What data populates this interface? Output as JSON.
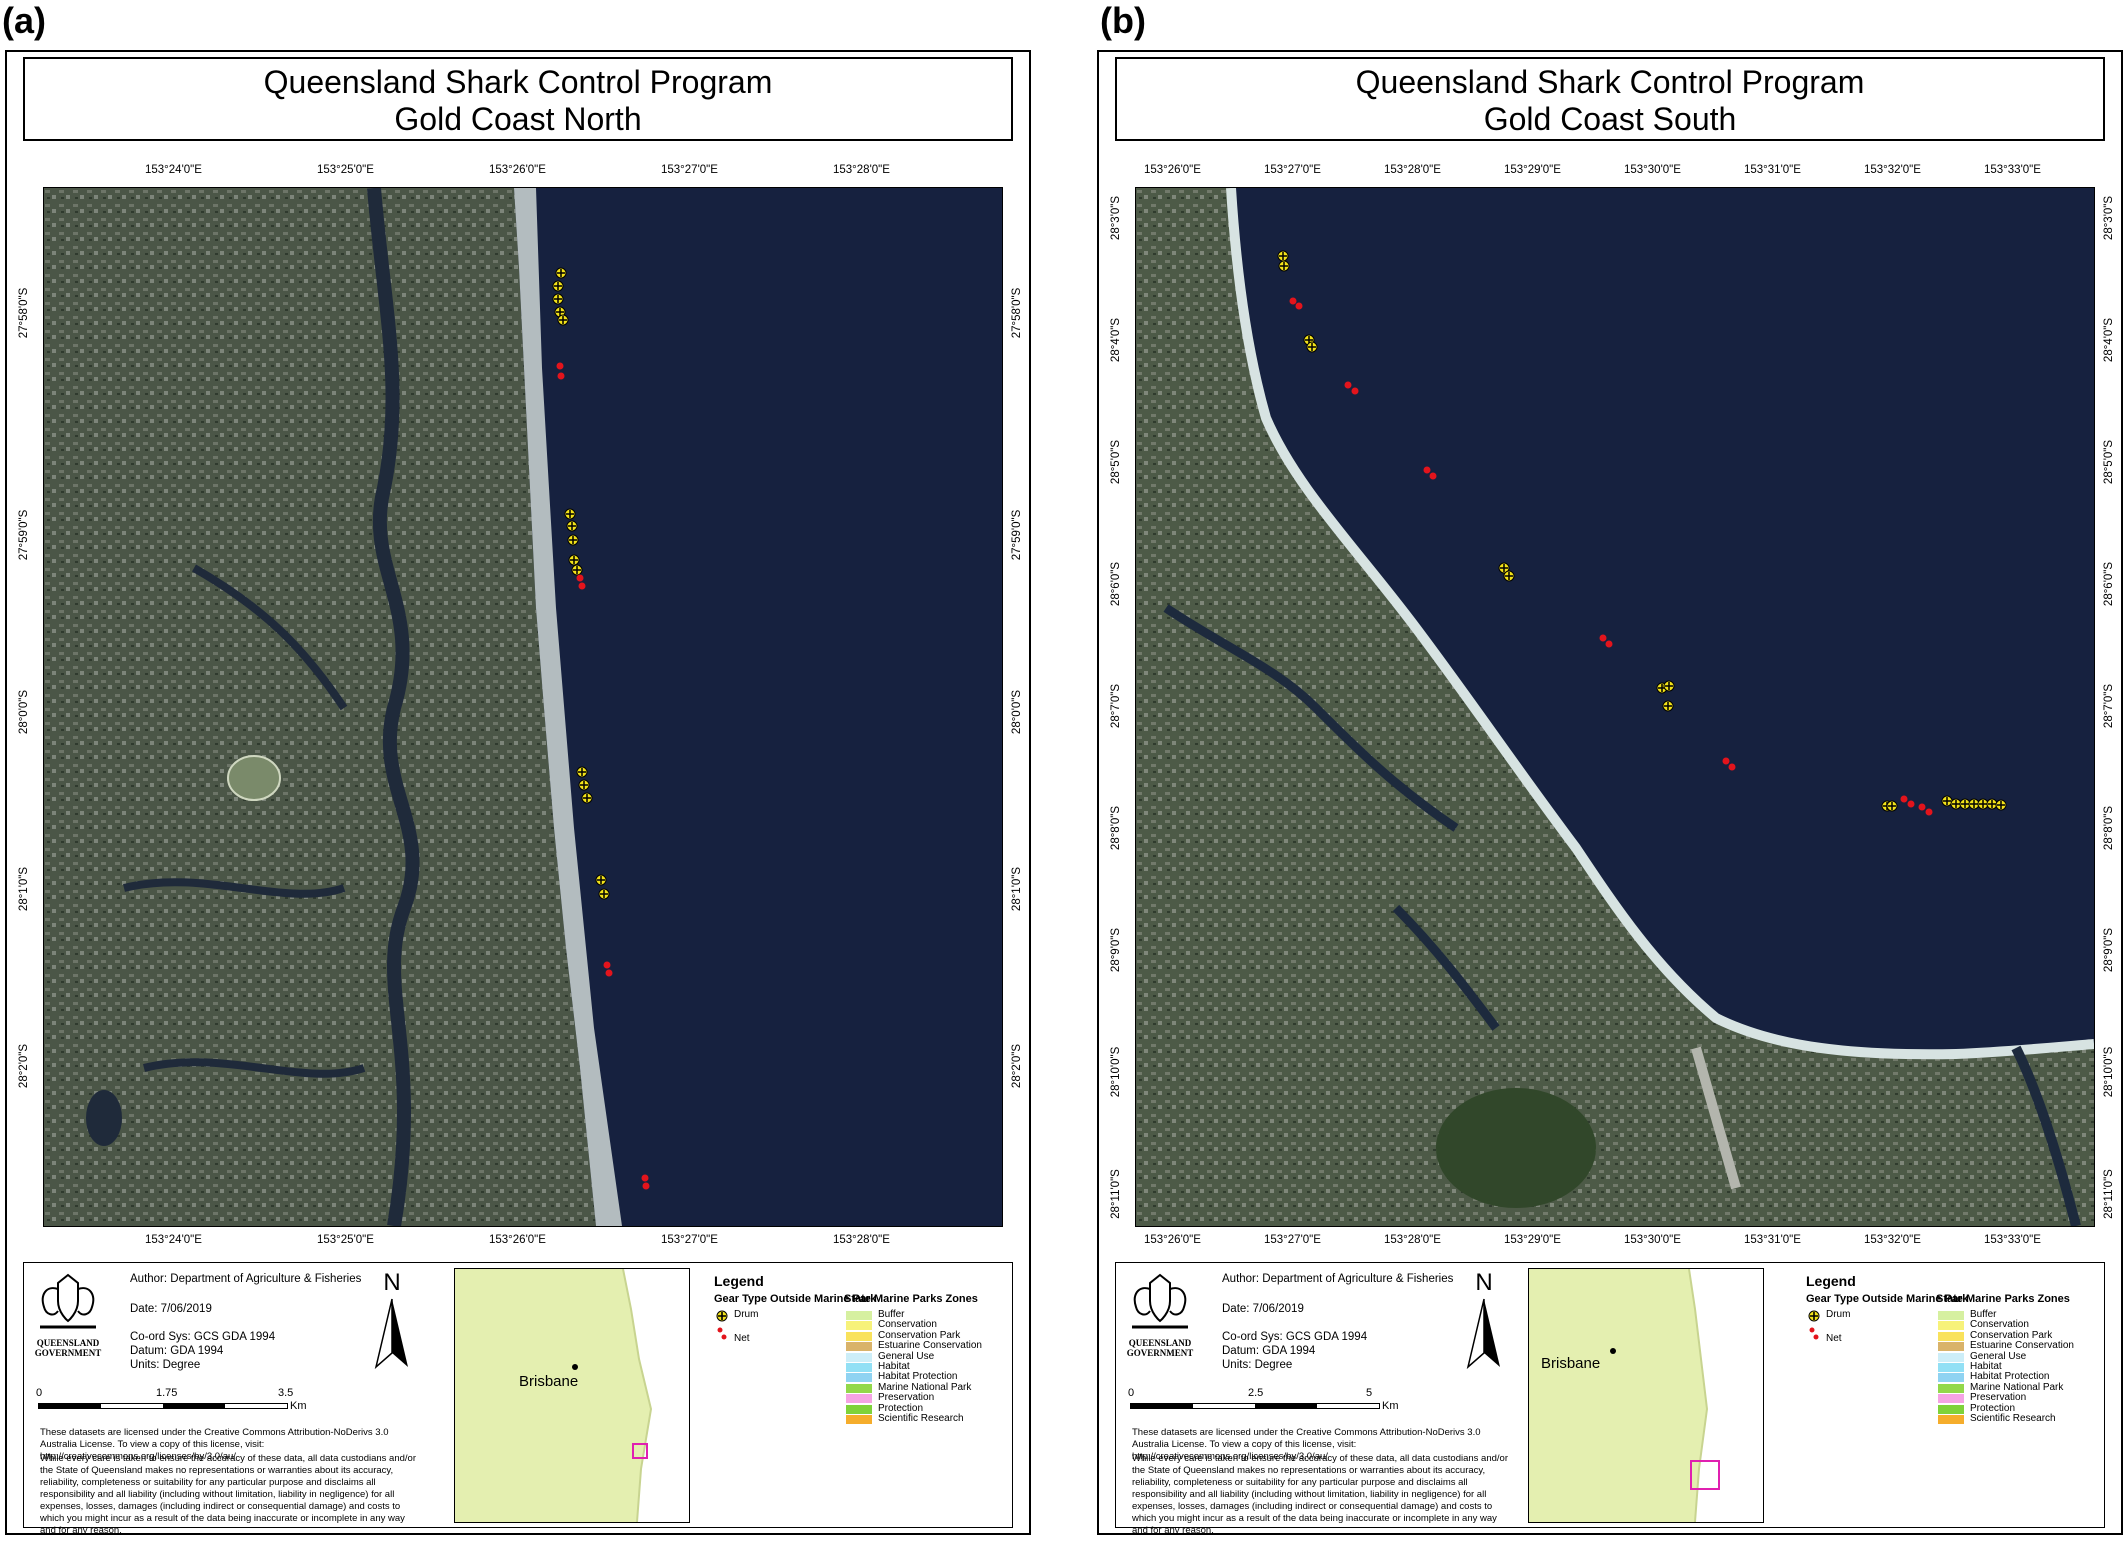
{
  "panels": [
    {
      "label": "(a)",
      "title_line1": "Queensland Shark Control Program",
      "title_line2": "Gold Coast North",
      "x_ticks": [
        "153°24'0\"E",
        "153°25'0\"E",
        "153°26'0\"E",
        "153°27'0\"E",
        "153°28'0\"E"
      ],
      "y_ticks": [
        "27°58'0\"S",
        "27°59'0\"S",
        "28°0'0\"S",
        "28°1'0\"S",
        "28°2'0\"S"
      ],
      "author": "Author: Department of Agriculture & Fisheries",
      "date": "Date: 7/06/2019",
      "coord_sys": "Co-ord Sys: GCS GDA 1994",
      "datum": "Datum: GDA 1994",
      "units": "Units: Degree",
      "north_label": "N",
      "scale_labels": [
        "0",
        "1.75",
        "3.5"
      ],
      "scale_unit": "Km",
      "license": "These datasets are licensed under the Creative Commons Attribution-NoDerivs 3.0 Australia License. To view a copy of this license, visit: http://creativecommons.org/licenses/by/3.0/au/",
      "disclaimer": "While every care is taken to ensure the accuracy of these data, all data custodians and/or the State of Queensland makes no representations or warranties about its accuracy, reliability, completeness or suitability for any particular purpose and disclaims all responsibility and all liability (including without limitation, liability in negligence) for all expenses, losses, damages (including indirect or consequential damage) and costs to which you might incur as a result of the data being inaccurate or incomplete in any way and for any reason.",
      "logo_text_1": "QUEENSLAND",
      "logo_text_2": "GOVERNMENT",
      "inset_city": "Brisbane"
    },
    {
      "label": "(b)",
      "title_line1": "Queensland Shark Control Program",
      "title_line2": "Gold Coast South",
      "x_ticks": [
        "153°26'0\"E",
        "153°27'0\"E",
        "153°28'0\"E",
        "153°29'0\"E",
        "153°30'0\"E",
        "153°31'0\"E",
        "153°32'0\"E",
        "153°33'0\"E"
      ],
      "y_ticks": [
        "28°3'0\"S",
        "28°4'0\"S",
        "28°5'0\"S",
        "28°6'0\"S",
        "28°7'0\"S",
        "28°8'0\"S",
        "28°9'0\"S",
        "28°10'0\"S",
        "28°11'0\"S"
      ],
      "author": "Author: Department of Agriculture & Fisheries",
      "date": "Date: 7/06/2019",
      "coord_sys": "Co-ord Sys: GCS GDA 1994",
      "datum": "Datum: GDA 1994",
      "units": "Units: Degree",
      "north_label": "N",
      "scale_labels": [
        "0",
        "2.5",
        "5"
      ],
      "scale_unit": "Km",
      "license": "These datasets are licensed under the Creative Commons Attribution-NoDerivs 3.0 Australia License. To view a copy of this license, visit: http://creativecommons.org/licenses/by/3.0/au/",
      "disclaimer": "While every care is taken to ensure the accuracy of these data, all data custodians and/or the State of Queensland makes no representations or warranties about its accuracy, reliability, completeness or suitability for any particular purpose and disclaims all responsibility and all liability (including without limitation, liability in negligence) for all expenses, losses, damages (including indirect or consequential damage) and costs to which you might incur as a result of the data being inaccurate or incomplete in any way and for any reason.",
      "logo_text_1": "QUEENSLAND",
      "logo_text_2": "GOVERNMENT",
      "inset_city": "Brisbane"
    }
  ],
  "legend": {
    "title": "Legend",
    "gear_heading": "Gear Type Outside Marine Park",
    "gear_items": [
      {
        "label": "Drum",
        "icon": "drum-marker"
      },
      {
        "label": "Net",
        "icon": "net-marker"
      }
    ],
    "zones_heading": "State Marine Parks Zones",
    "zones": [
      {
        "label": "Buffer",
        "color": "#d6f0a0"
      },
      {
        "label": "Conservation",
        "color": "#f7f27a"
      },
      {
        "label": "Conservation Park",
        "color": "#f9e25c"
      },
      {
        "label": "Estuarine Conservation",
        "color": "#d9b36a"
      },
      {
        "label": "General Use",
        "color": "#cdeef8"
      },
      {
        "label": "Habitat",
        "color": "#92e0f5"
      },
      {
        "label": "Habitat Protection",
        "color": "#8fd3f2"
      },
      {
        "label": "Marine National Park",
        "color": "#92d84a"
      },
      {
        "label": "Preservation",
        "color": "#f5a3e4"
      },
      {
        "label": "Protection",
        "color": "#7fd23a"
      },
      {
        "label": "Scientific Research",
        "color": "#f5ad2c"
      }
    ]
  },
  "colors": {
    "ocean": "#16213f",
    "land": "#4a5542",
    "drum": "#f2e21a",
    "net": "#e3141c",
    "inset_land": "#e4efb0",
    "inset_box": "#e020b0"
  }
}
